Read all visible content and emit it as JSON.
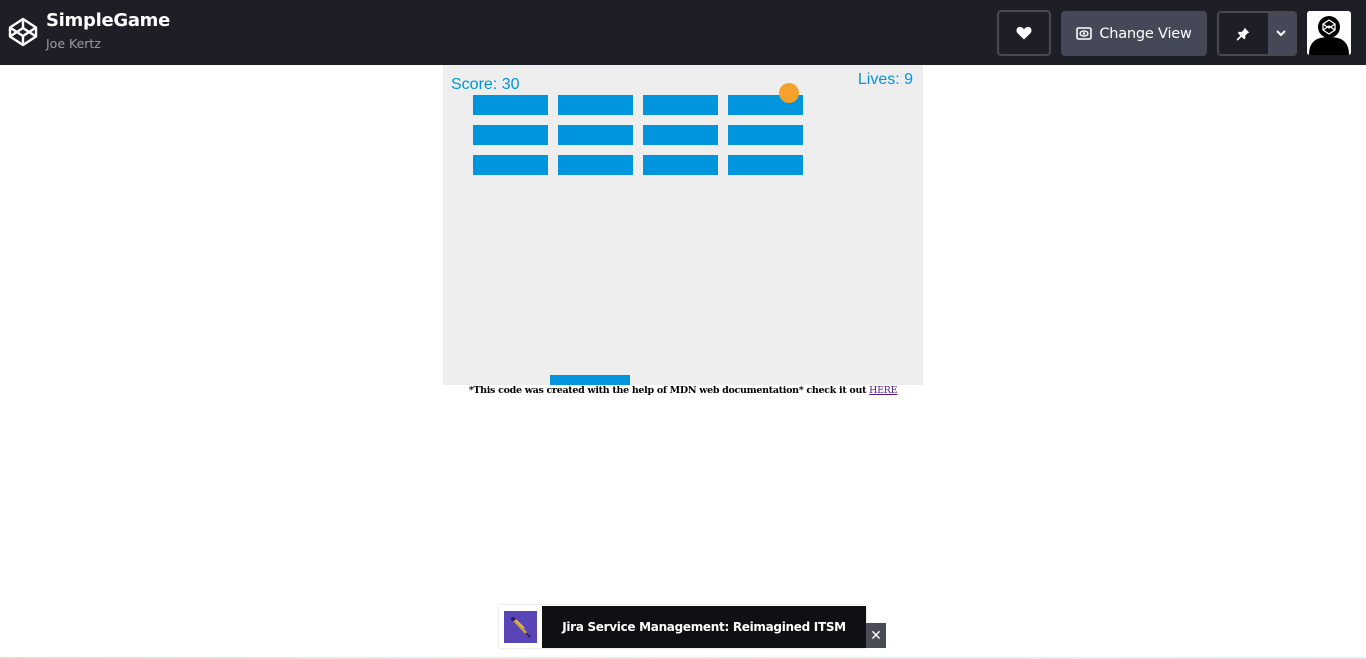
{
  "header": {
    "title": "SimpleGame",
    "author": "Joe Kertz",
    "change_view_label": "Change View",
    "icons": {
      "logo": "codepen-logo-icon",
      "heart": "heart-icon",
      "change_view": "eye-icon",
      "pin": "pin-icon",
      "caret": "chevron-down-icon",
      "avatar": "user-avatar"
    }
  },
  "game": {
    "score_text": "Score: 30",
    "lives_text": "Lives: 9",
    "brick_rows": 3,
    "brick_columns": 4,
    "colors": {
      "background": "#eeeeee",
      "brick": "#0095dd",
      "paddle": "#0095dd",
      "ball": "#f6a12c",
      "hud": "#0095dd"
    }
  },
  "credit": {
    "text": "*This code was created with the help of MDN web documentation* check it out ",
    "link_label": "HERE"
  },
  "ad": {
    "text": "Jira Service Management: Reimagined ITSM",
    "close_label": "✕"
  }
}
